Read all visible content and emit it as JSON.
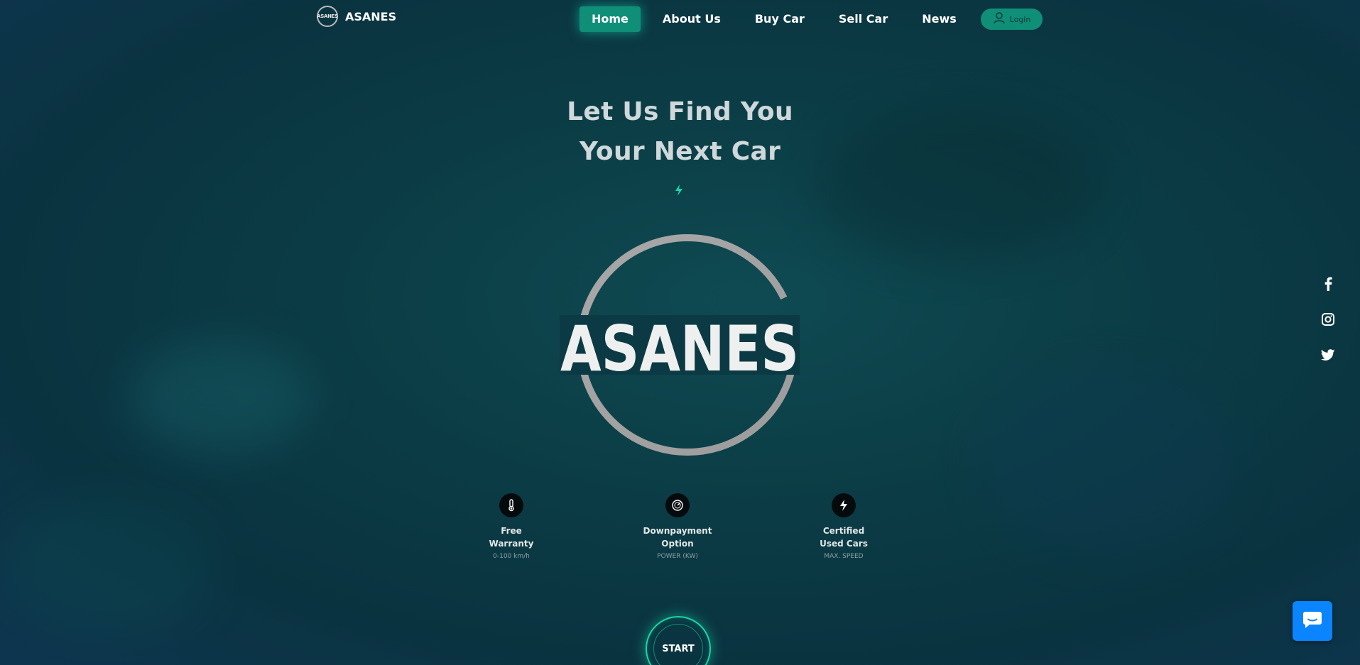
{
  "brand": {
    "logo_text": "ASANES",
    "name": "ASANES"
  },
  "nav": {
    "items": [
      {
        "label": "Home",
        "active": true
      },
      {
        "label": "About Us",
        "active": false
      },
      {
        "label": "Buy Car",
        "active": false
      },
      {
        "label": "Sell Car",
        "active": false
      },
      {
        "label": "News",
        "active": false
      }
    ],
    "login_label": "Login"
  },
  "hero": {
    "title_line1": "Let Us Find You",
    "title_line2": "Your Next Car",
    "logo_text": "ASANES"
  },
  "features": [
    {
      "icon": "thermometer-icon",
      "title": "Free\nWarranty",
      "sub": "0-100 km/h"
    },
    {
      "icon": "speedometer-icon",
      "title": "Downpayment\nOption",
      "sub": "POWER (KW)"
    },
    {
      "icon": "bolt-icon",
      "title": "Certified\nUsed Cars",
      "sub": "MAX. SPEED"
    }
  ],
  "start_label": "START",
  "social": [
    "facebook-icon",
    "instagram-icon",
    "twitter-icon"
  ],
  "colors": {
    "accent": "#0f8f78",
    "glow": "#18d8a6",
    "chat": "#0a84ff",
    "background": "#0b3c45"
  }
}
